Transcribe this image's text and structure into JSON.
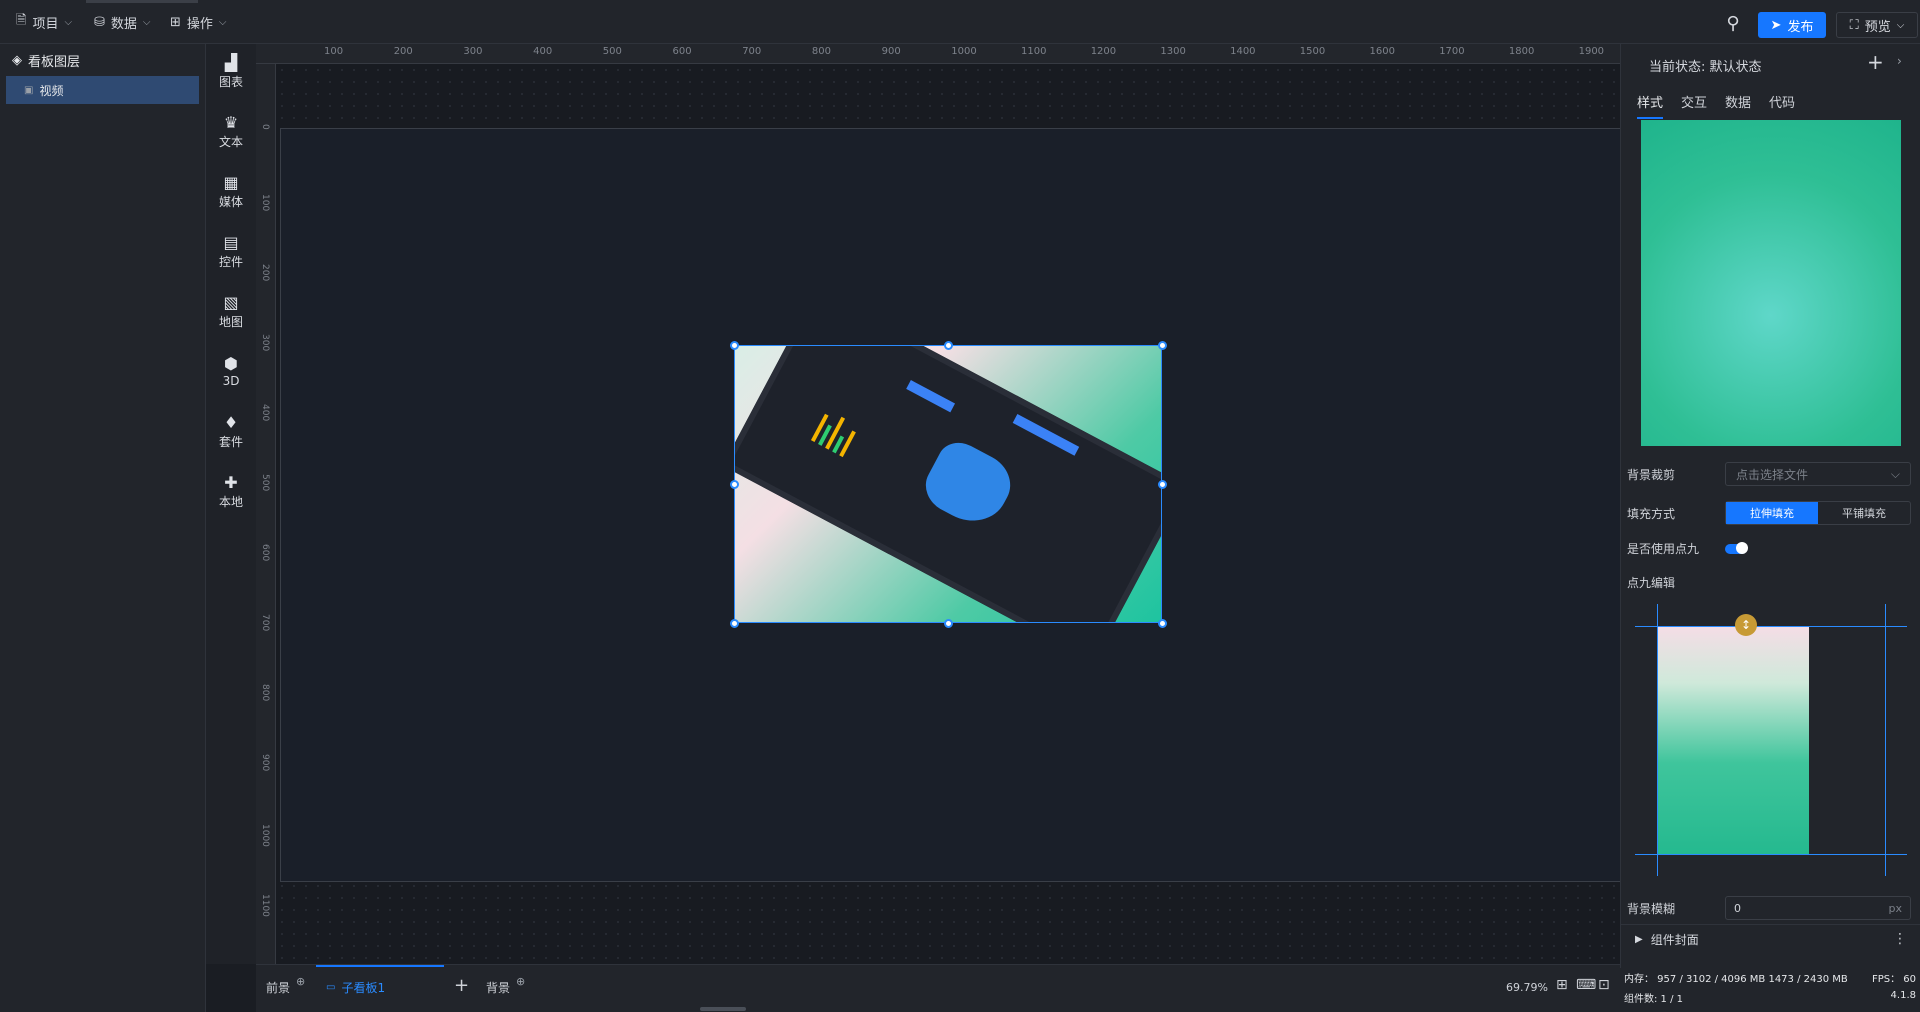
{
  "topbar": {
    "menus": [
      {
        "label": "项目",
        "icon": "file-icon"
      },
      {
        "label": "数据",
        "icon": "database-icon"
      },
      {
        "label": "操作",
        "icon": "grid-icon"
      }
    ],
    "publish_label": "发布",
    "preview_label": "预览"
  },
  "layers": {
    "header": "看板图层",
    "items": [
      {
        "label": "视频"
      }
    ]
  },
  "tools": [
    {
      "label": "图表",
      "icon": "bar-chart-icon"
    },
    {
      "label": "文本",
      "icon": "crown-text-icon"
    },
    {
      "label": "媒体",
      "icon": "media-icon"
    },
    {
      "label": "控件",
      "icon": "widget-icon"
    },
    {
      "label": "地图",
      "icon": "map-icon"
    },
    {
      "label": "3D",
      "icon": "cube-icon"
    },
    {
      "label": "套件",
      "icon": "shirt-icon"
    },
    {
      "label": "本地",
      "icon": "puzzle-icon"
    }
  ],
  "ruler": {
    "top_labels": [
      "100",
      "200",
      "300",
      "400",
      "500",
      "600",
      "700",
      "800",
      "900",
      "1000",
      "1100",
      "1200",
      "1300",
      "1400",
      "1500",
      "1600",
      "1700",
      "1800",
      "1900"
    ],
    "left_labels": [
      "0",
      "100",
      "200",
      "300",
      "400",
      "500",
      "600",
      "700",
      "800",
      "900",
      "1000",
      "1100"
    ]
  },
  "right_panel": {
    "state_label": "当前状态:",
    "state_value": "默认状态",
    "tabs": [
      "样式",
      "交互",
      "数据",
      "代码"
    ],
    "bg_crop_label": "背景裁剪",
    "bg_crop_placeholder": "点击选择文件",
    "fill_label": "填充方式",
    "fill_options": [
      "拉伸填充",
      "平铺填充"
    ],
    "use_nine_label": "是否使用点九",
    "nine_edit_label": "点九编辑",
    "blur_label": "背景模糊",
    "blur_value": "0",
    "blur_unit": "px",
    "cover_label": "组件封面"
  },
  "bottom": {
    "tabs": [
      {
        "label": "前景"
      },
      {
        "label": "子看板1"
      },
      {
        "label": "背景"
      }
    ],
    "zoom": "69.79%"
  },
  "status": {
    "memory": "内存： 957 / 3102 / 4096 MB  1473 / 2430 MB",
    "fps": "FPS： 60",
    "count": "组件数: 1 / 1",
    "version": "4.1.8"
  },
  "colors": {
    "accent": "#1677ff",
    "panel": "#22252b",
    "canvas": "#181b21"
  }
}
